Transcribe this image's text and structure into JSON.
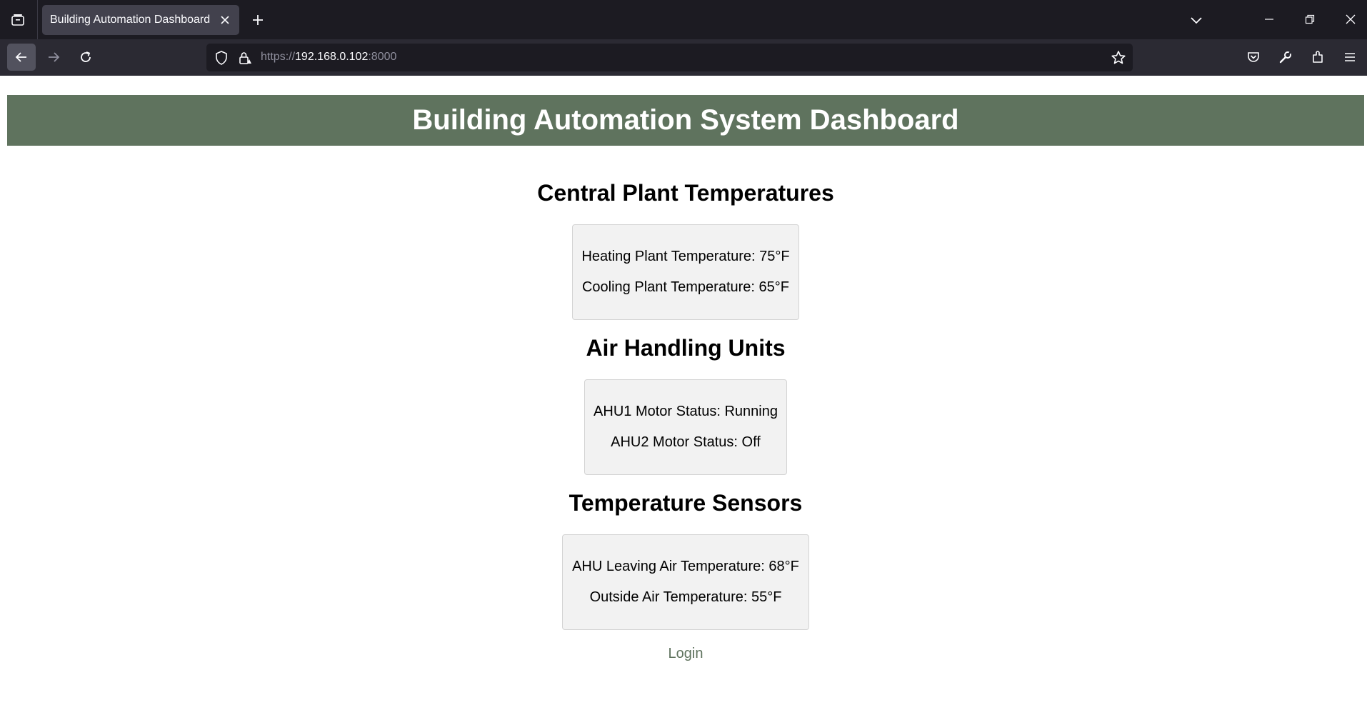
{
  "browser": {
    "tab": {
      "title": "Building Automation Dashboard"
    },
    "url": {
      "scheme": "https://",
      "host": "192.168.0.102",
      "port": ":8000"
    }
  },
  "page": {
    "header_title": "Building Automation System Dashboard",
    "sections": [
      {
        "title": "Central Plant Temperatures",
        "items": [
          "Heating Plant Temperature: 75°F",
          "Cooling Plant Temperature: 65°F"
        ]
      },
      {
        "title": "Air Handling Units",
        "items": [
          "AHU1 Motor Status: Running",
          "AHU2 Motor Status: Off"
        ]
      },
      {
        "title": "Temperature Sensors",
        "items": [
          "AHU Leaving Air Temperature: 68°F",
          "Outside Air Temperature: 55°F"
        ]
      }
    ],
    "login_label": "Login"
  },
  "colors": {
    "header_bg": "#5f735e",
    "card_bg": "#f2f2f2",
    "link": "#5f735e"
  }
}
